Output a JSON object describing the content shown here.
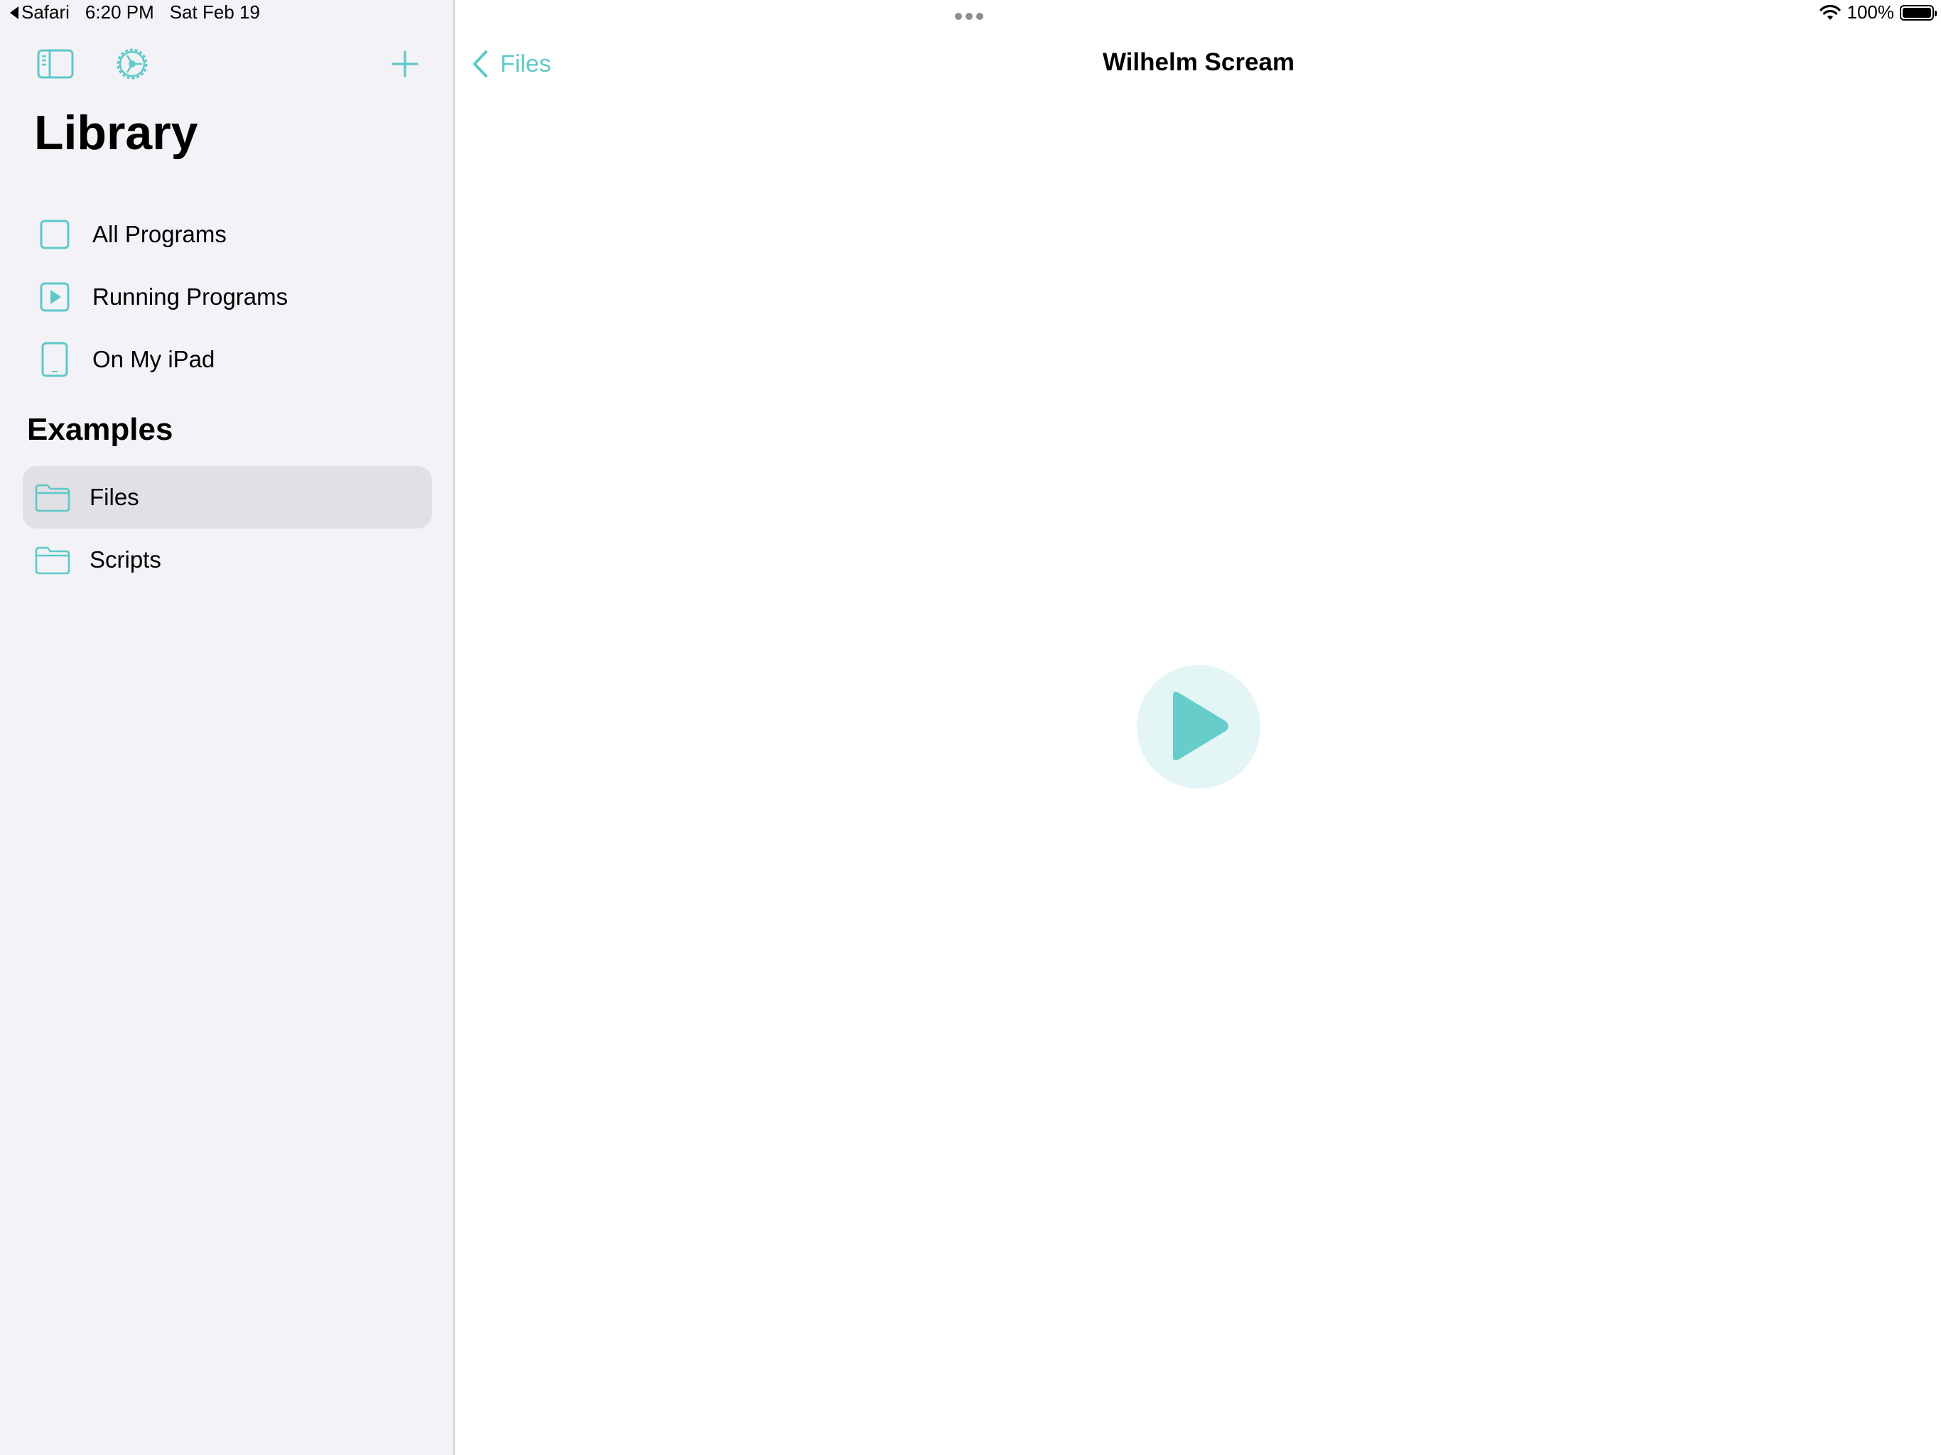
{
  "status_bar": {
    "back_app": "Safari",
    "time": "6:20 PM",
    "date": "Sat Feb 19",
    "battery": "100%"
  },
  "sidebar": {
    "title": "Library",
    "items": [
      {
        "label": "All Programs",
        "icon": "square-icon"
      },
      {
        "label": "Running Programs",
        "icon": "play-square-icon"
      },
      {
        "label": "On My iPad",
        "icon": "ipad-icon"
      }
    ],
    "section_title": "Examples",
    "examples": [
      {
        "label": "Files",
        "icon": "folder-icon",
        "selected": true
      },
      {
        "label": "Scripts",
        "icon": "folder-icon",
        "selected": false
      }
    ],
    "toolbar_icons": [
      "sidebar-toggle-icon",
      "settings-gear-icon",
      "plus-icon"
    ]
  },
  "main": {
    "back_label": "Files",
    "title": "Wilhelm Scream",
    "play_icon": "play-icon"
  },
  "colors": {
    "accent": "#5ec8c8",
    "play_bg": "#e3f5f4",
    "sidebar_bg": "#f2f2f7",
    "selected_bg": "#e0e0e5"
  }
}
